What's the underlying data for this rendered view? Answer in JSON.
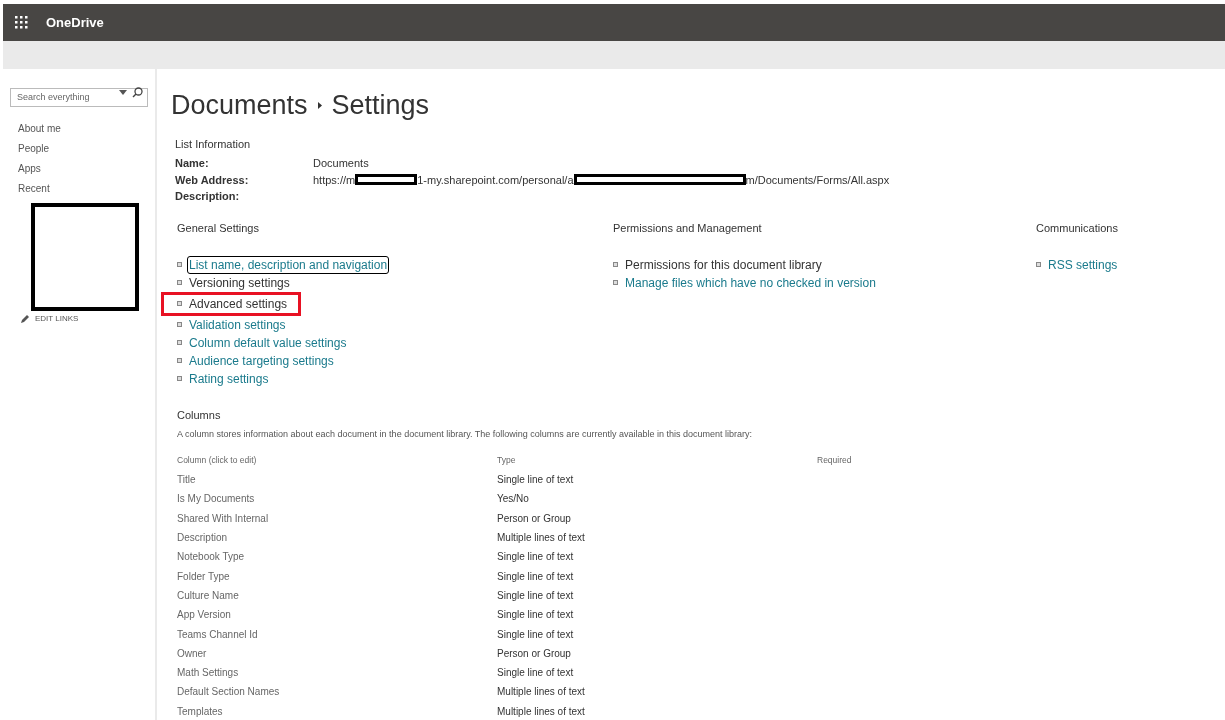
{
  "app_bar": {
    "title": "OneDrive"
  },
  "sidebar": {
    "search": {
      "placeholder": "Search everything"
    },
    "items": [
      {
        "label": "About me"
      },
      {
        "label": "People"
      },
      {
        "label": "Apps"
      },
      {
        "label": "Recent"
      }
    ],
    "edit_links": "EDIT LINKS"
  },
  "page_title": {
    "parent": "Documents",
    "current": "Settings"
  },
  "list_information": {
    "heading": "List Information",
    "fields": [
      {
        "label": "Name:",
        "value": [
          "Documents"
        ]
      },
      {
        "label": "Web Address:",
        "value": [
          "https://m",
          "1-my.sharepoint.com/personal/a",
          "m/Documents/Forms/All.aspx"
        ]
      },
      {
        "label": "Description:"
      }
    ]
  },
  "setting_groups": [
    {
      "heading": "General Settings",
      "links": [
        {
          "label": "List name, description and navigation",
          "visited": false,
          "focused": true,
          "highlighted": false
        },
        {
          "label": "Versioning settings",
          "visited": true,
          "focused": false,
          "highlighted": false
        },
        {
          "label": "Advanced settings",
          "visited": true,
          "focused": false,
          "highlighted": true
        },
        {
          "label": "Validation settings",
          "visited": false,
          "focused": false,
          "highlighted": false
        },
        {
          "label": "Column default value settings",
          "visited": false,
          "focused": false,
          "highlighted": false
        },
        {
          "label": "Audience targeting settings",
          "visited": false,
          "focused": false,
          "highlighted": false
        },
        {
          "label": "Rating settings",
          "visited": false,
          "focused": false,
          "highlighted": false
        }
      ]
    },
    {
      "heading": "Permissions and Management",
      "links": [
        {
          "label": "Permissions for this document library",
          "visited": true,
          "focused": false,
          "highlighted": false
        },
        {
          "label": "Manage files which have no checked in version",
          "visited": false,
          "focused": false,
          "highlighted": false
        }
      ]
    },
    {
      "heading": "Communications",
      "links": [
        {
          "label": "RSS settings",
          "visited": false,
          "focused": false,
          "highlighted": false
        }
      ]
    }
  ],
  "columns": {
    "heading": "Columns",
    "description": "A column stores information about each document in the document library. The following columns are currently available in this document library:",
    "table": {
      "columns": [
        "Column (click to edit)",
        "Type",
        "Required"
      ],
      "rows": [
        [
          "Title",
          "Single line of text"
        ],
        [
          "Is My Documents",
          "Yes/No"
        ],
        [
          "Shared With Internal",
          "Person or Group"
        ],
        [
          "Description",
          "Multiple lines of text"
        ],
        [
          "Notebook Type",
          "Single line of text"
        ],
        [
          "Folder Type",
          "Single line of text"
        ],
        [
          "Culture Name",
          "Single line of text"
        ],
        [
          "App Version",
          "Single line of text"
        ],
        [
          "Teams Channel Id",
          "Single line of text"
        ],
        [
          "Owner",
          "Person or Group"
        ],
        [
          "Math Settings",
          "Single line of text"
        ],
        [
          "Default Section Names",
          "Multiple lines of text"
        ],
        [
          "Templates",
          "Multiple lines of text"
        ]
      ]
    }
  }
}
